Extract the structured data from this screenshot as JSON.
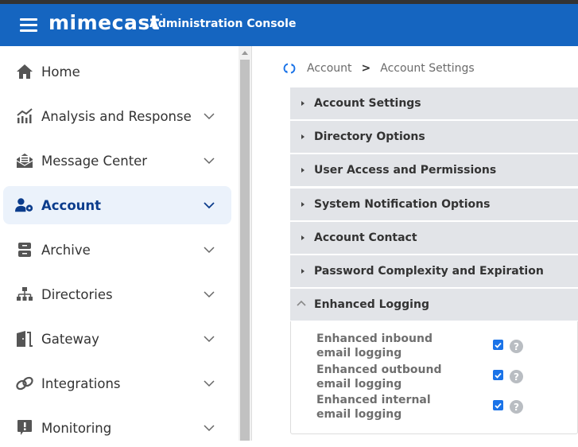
{
  "header": {
    "brand": "mimecast",
    "title": "Administration Console",
    "color": "#1565c0"
  },
  "sidebar": {
    "items": [
      {
        "label": "Home",
        "icon": "home-icon",
        "expandable": false,
        "active": false
      },
      {
        "label": "Analysis and Response",
        "icon": "chart-icon",
        "expandable": true,
        "active": false
      },
      {
        "label": "Message Center",
        "icon": "envelope-open-icon",
        "expandable": true,
        "active": false
      },
      {
        "label": "Account",
        "icon": "user-gear-icon",
        "expandable": true,
        "active": true
      },
      {
        "label": "Archive",
        "icon": "archive-icon",
        "expandable": true,
        "active": false
      },
      {
        "label": "Directories",
        "icon": "sitemap-icon",
        "expandable": true,
        "active": false
      },
      {
        "label": "Gateway",
        "icon": "door-icon",
        "expandable": true,
        "active": false
      },
      {
        "label": "Integrations",
        "icon": "link-icon",
        "expandable": true,
        "active": false
      },
      {
        "label": "Monitoring",
        "icon": "alert-icon",
        "expandable": true,
        "active": false
      }
    ]
  },
  "breadcrumb": {
    "items": [
      "Account",
      "Account Settings"
    ],
    "separator": ">"
  },
  "panels": [
    {
      "label": "Account Settings",
      "expanded": false
    },
    {
      "label": "Directory Options",
      "expanded": false
    },
    {
      "label": "User Access and Permissions",
      "expanded": false
    },
    {
      "label": "System Notification Options",
      "expanded": false
    },
    {
      "label": "Account Contact",
      "expanded": false
    },
    {
      "label": "Password Complexity and Expiration",
      "expanded": false
    },
    {
      "label": "Enhanced Logging",
      "expanded": true
    }
  ],
  "enhanced_logging": {
    "options": [
      {
        "label": "Enhanced inbound email logging",
        "checked": true,
        "help": "?"
      },
      {
        "label": "Enhanced outbound email logging",
        "checked": true,
        "help": "?"
      },
      {
        "label": "Enhanced internal email logging",
        "checked": true,
        "help": "?"
      }
    ]
  }
}
